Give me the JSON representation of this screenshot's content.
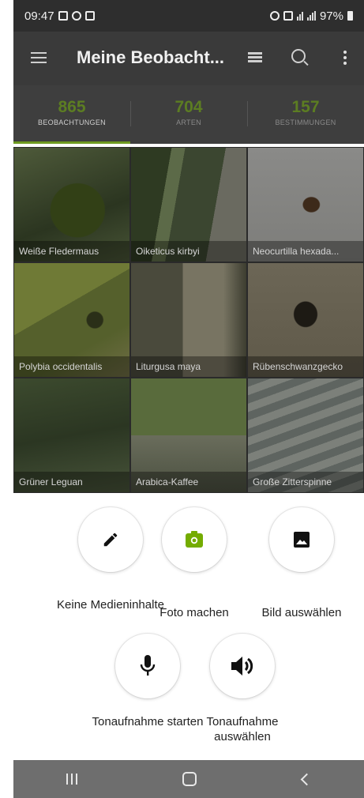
{
  "status_bar": {
    "time": "09:47",
    "battery": "97%"
  },
  "app_bar": {
    "title": "Meine Beobacht..."
  },
  "stats": [
    {
      "value": "865",
      "label": "BEOBACHTUNGEN"
    },
    {
      "value": "704",
      "label": "ARTEN"
    },
    {
      "value": "157",
      "label": "BESTIMMUNGEN"
    }
  ],
  "observations": [
    {
      "name": "Weiße Fledermaus"
    },
    {
      "name": "Oiketicus kirbyi"
    },
    {
      "name": "Neocurtilla hexada..."
    },
    {
      "name": "Polybia occidentalis"
    },
    {
      "name": "Liturgusa maya"
    },
    {
      "name": "Rübenschwanzgecko"
    },
    {
      "name": "Grüner Leguan"
    },
    {
      "name": "Arabica-Kaffee"
    },
    {
      "name": "Große Zitterspinne"
    }
  ],
  "actions": {
    "no_media": "Keine Medieninhalte",
    "take_photo": "Foto machen",
    "choose_image": "Bild auswählen",
    "start_recording": "Tonaufnahme starten",
    "choose_recording": "Tonaufnahme auswählen"
  },
  "colors": {
    "accent": "#74ac00",
    "appbar": "#3a3a3a",
    "statnum": "#5c7d22"
  }
}
